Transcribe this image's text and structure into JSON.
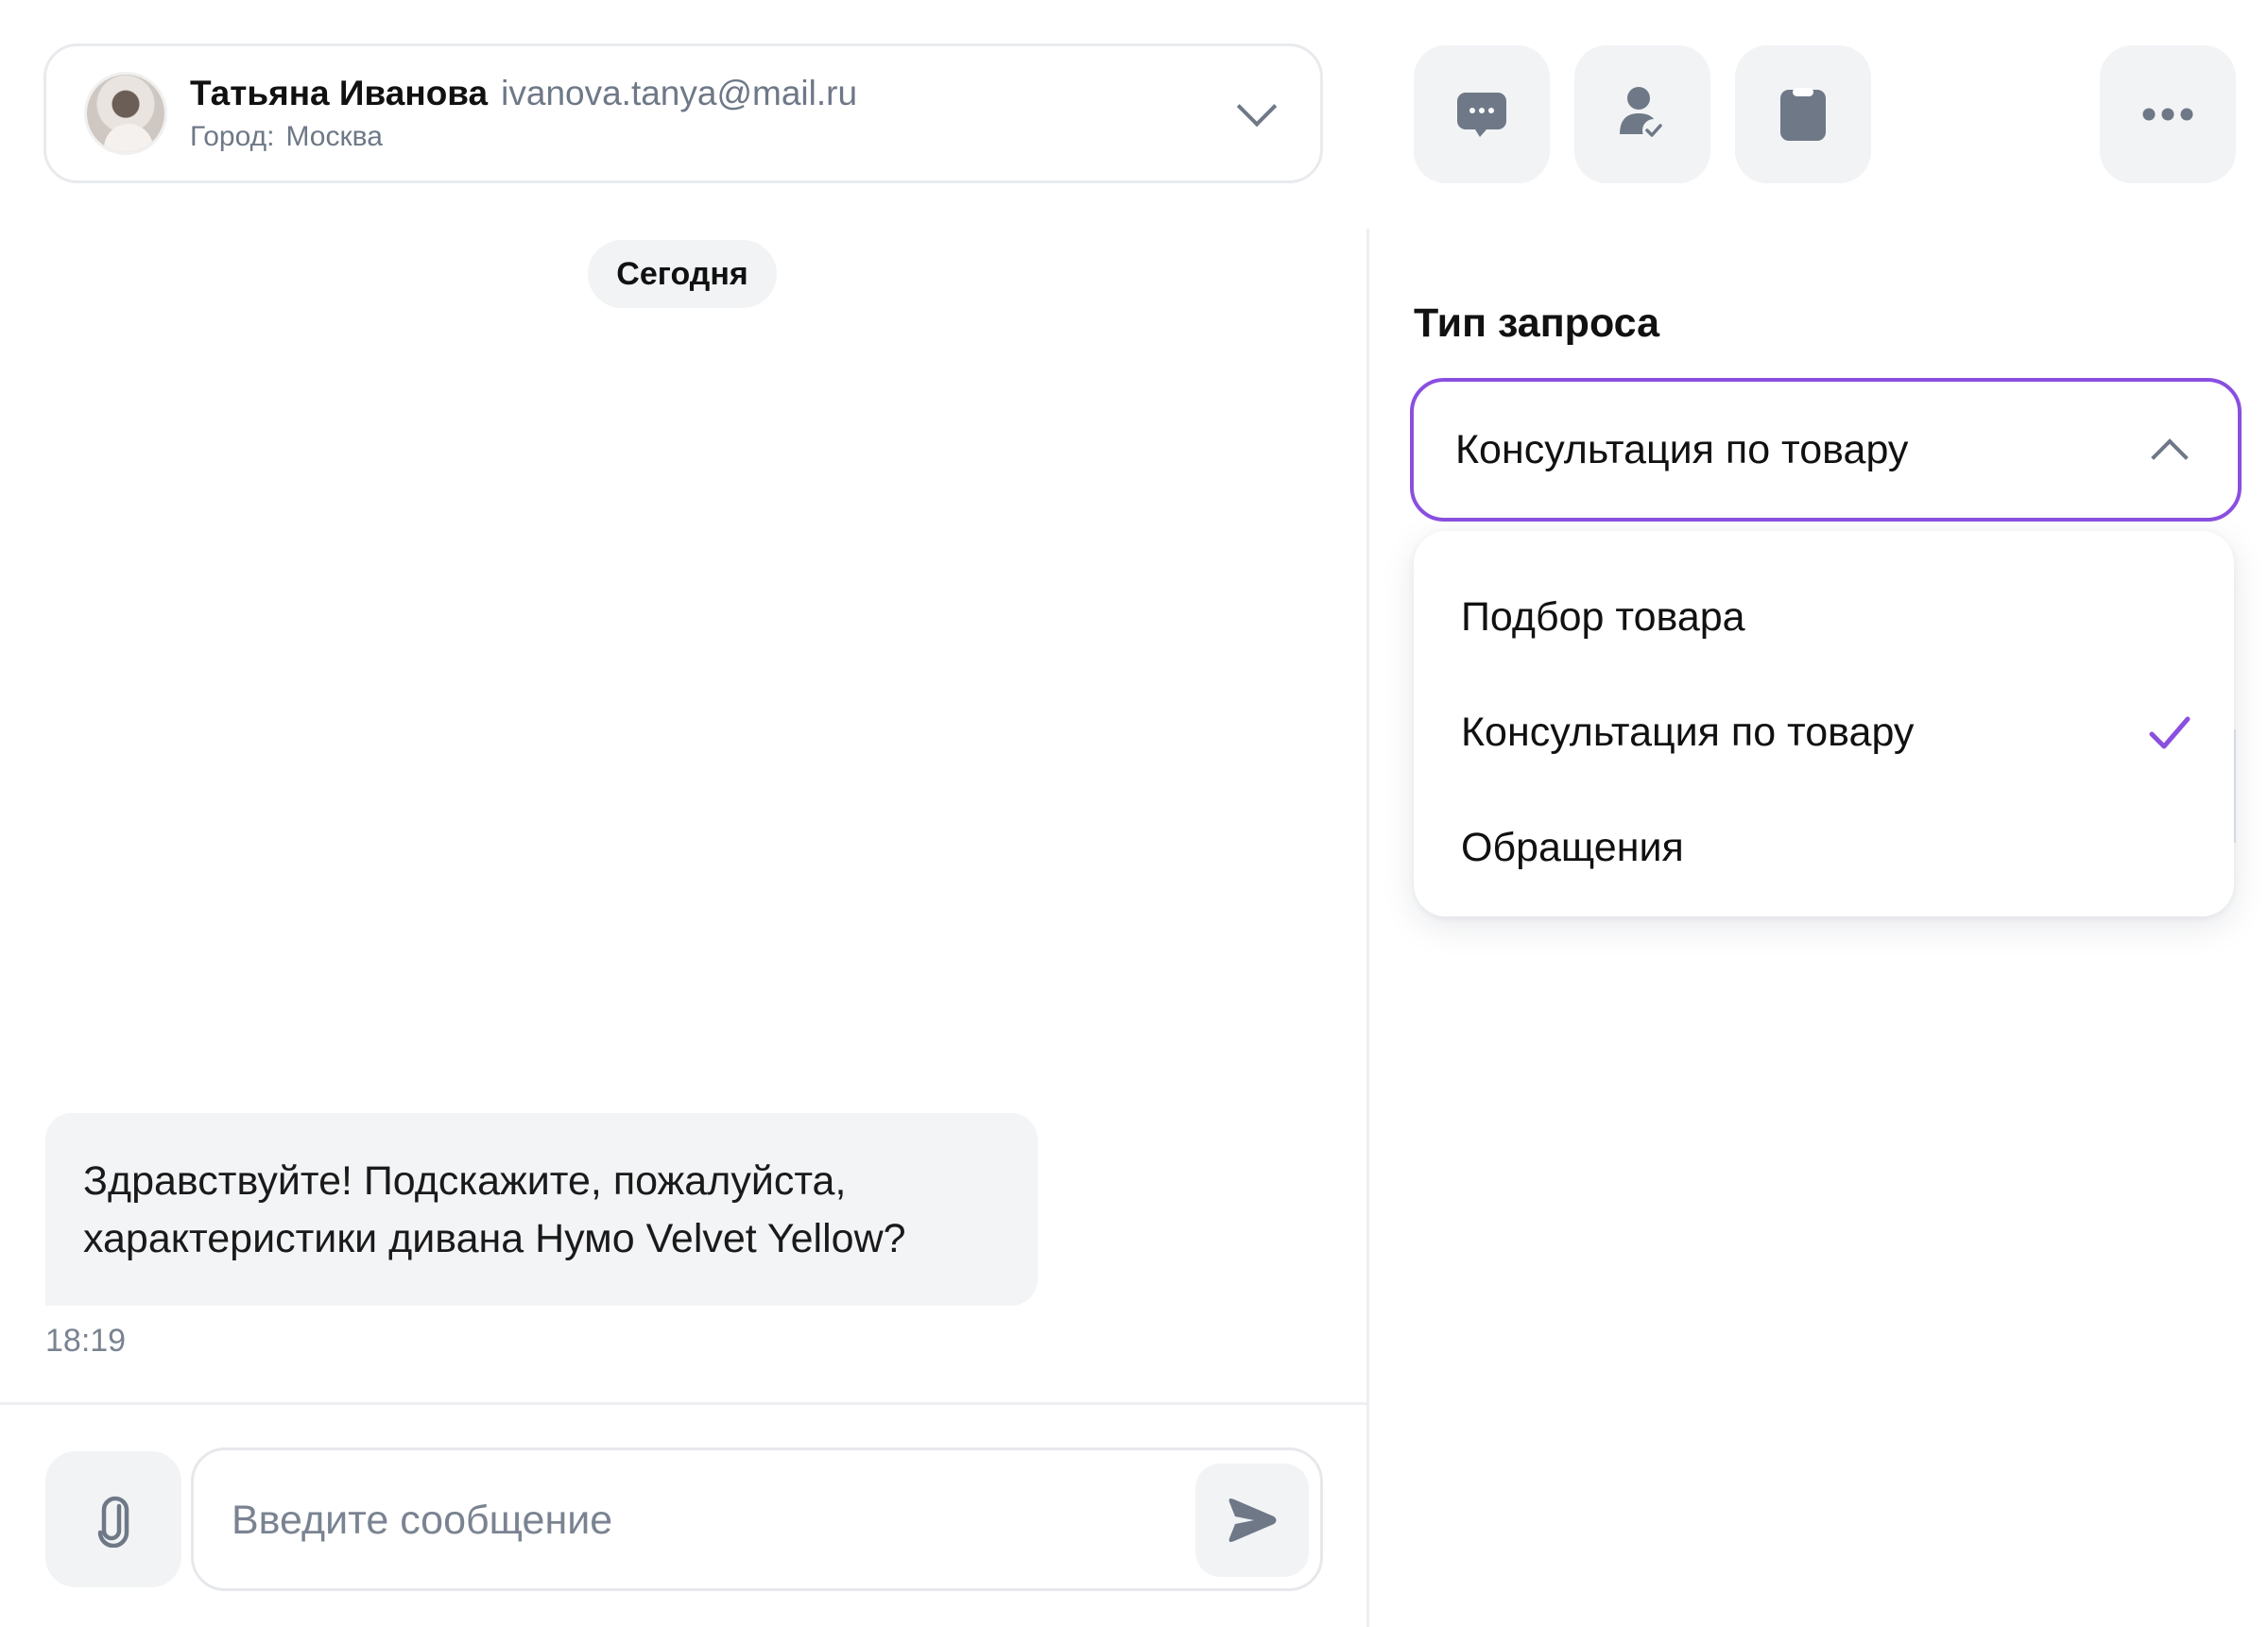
{
  "contact": {
    "name": "Татьяна Иванова",
    "email": "ivanova.tanya@mail.ru",
    "city_label": "Город:",
    "city_value": "Москва"
  },
  "chat": {
    "date_chip": "Сегодня",
    "messages": [
      {
        "line1": "Здравствуйте! Подскажите, пожалуйста,",
        "line2": "характеристики дивана Нумо Velvet Yellow?",
        "time": "18:19"
      }
    ],
    "composer": {
      "placeholder": "Введите сообщение"
    }
  },
  "toolbar": {
    "buttons": [
      {
        "icon": "chat-bubble-icon"
      },
      {
        "icon": "user-check-icon"
      },
      {
        "icon": "clipboard-icon"
      },
      {
        "icon": "more-icon"
      }
    ]
  },
  "request_panel": {
    "label": "Тип запроса",
    "selected": "Консультация по товару",
    "options": [
      {
        "label": "Подбор товара",
        "checked": false
      },
      {
        "label": "Консультация по товару",
        "checked": true
      },
      {
        "label": "Обращения",
        "checked": false
      }
    ]
  },
  "colors": {
    "accent": "#8a4fe0",
    "icon_gray": "#6e7887",
    "surface": "#f2f3f5",
    "border": "#e8eaee"
  }
}
